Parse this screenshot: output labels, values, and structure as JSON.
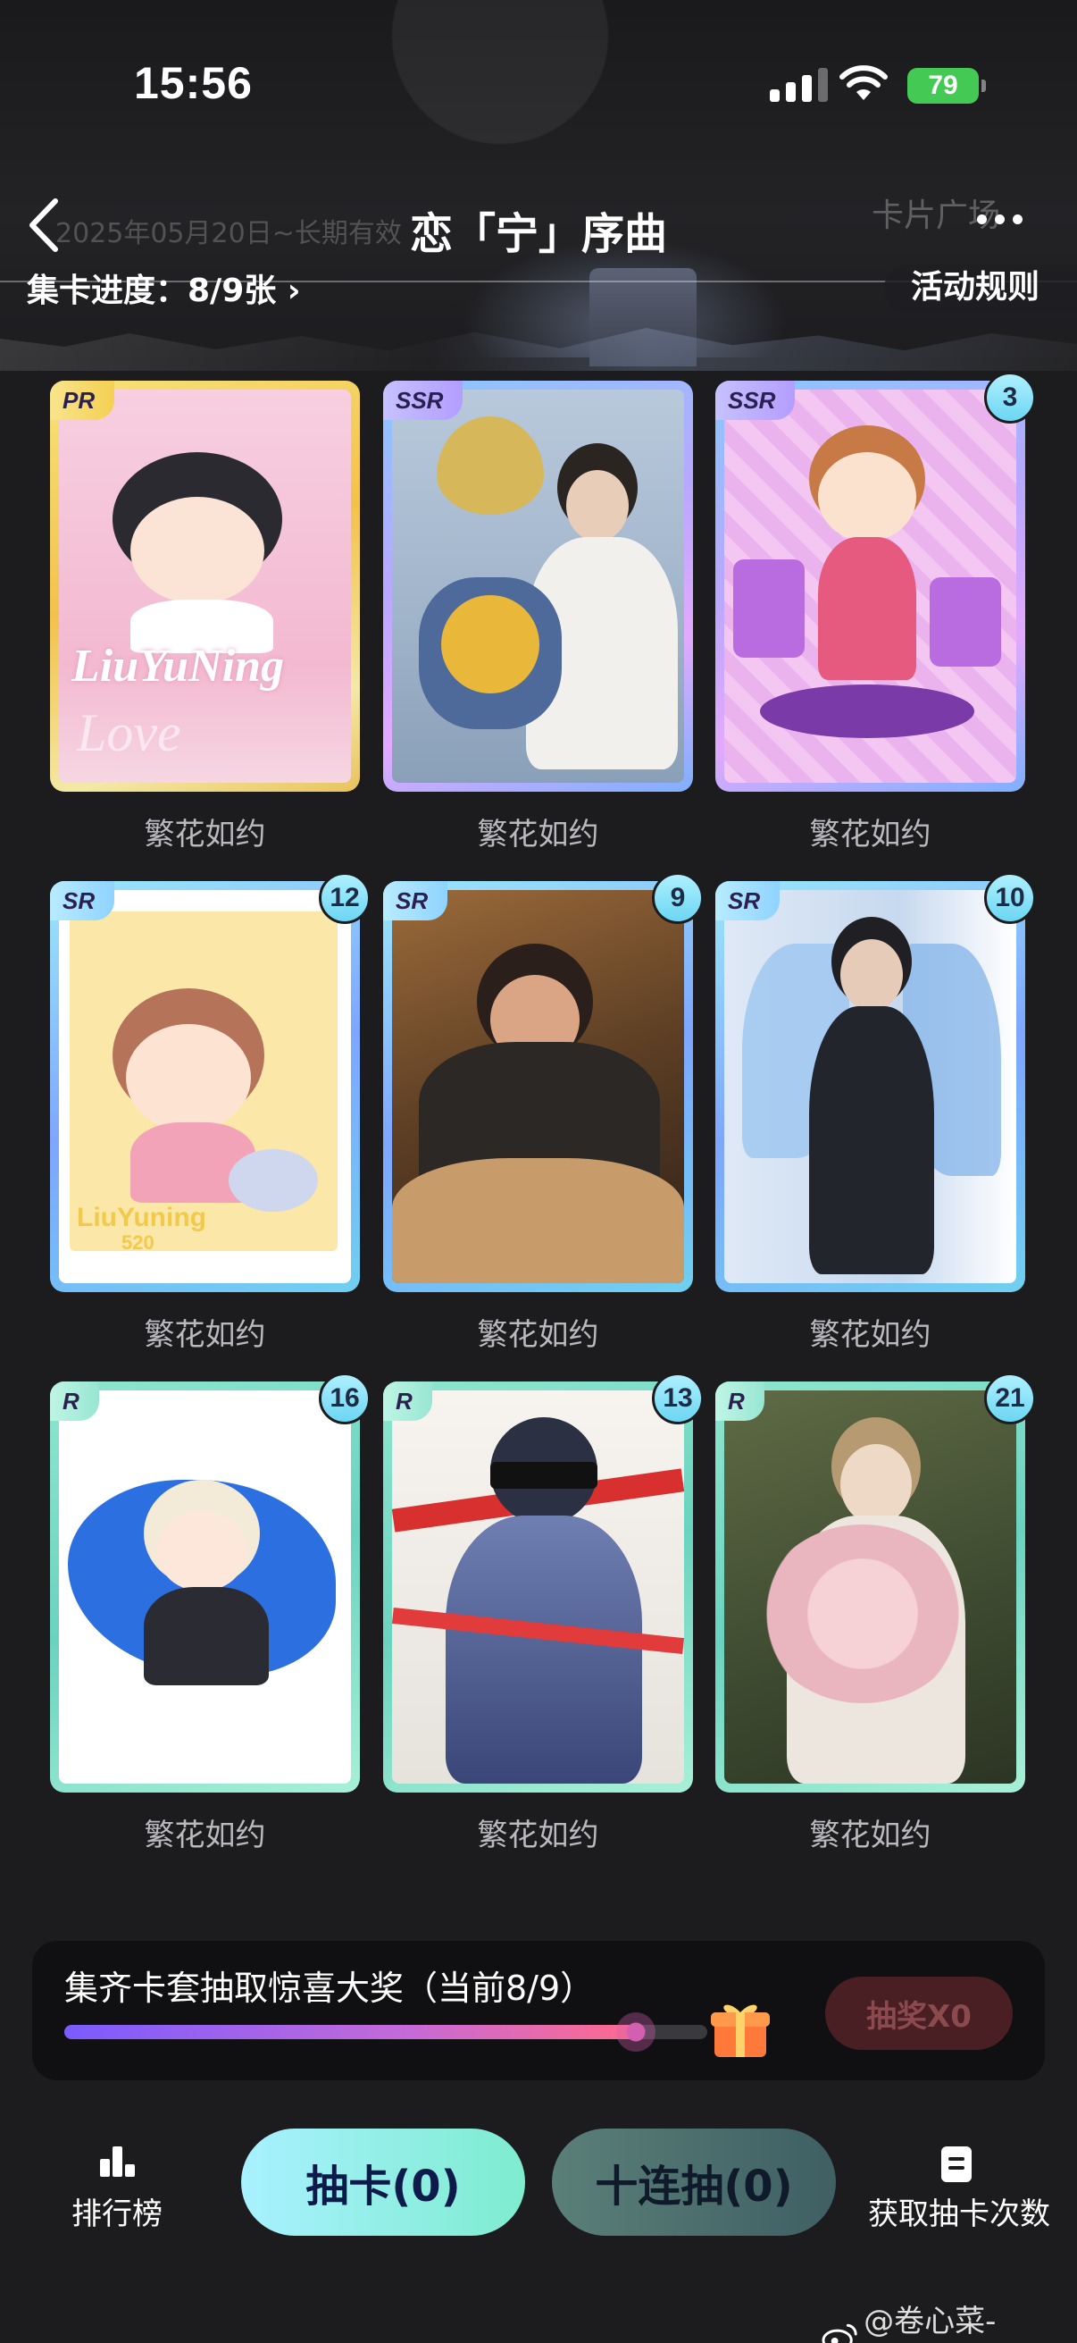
{
  "status_bar": {
    "time": "15:56",
    "battery": "79"
  },
  "nav": {
    "title": "恋「宁」序曲",
    "ghost_left": "2025年05月20日~长期有效",
    "ghost_right": "卡片广场"
  },
  "progress": {
    "label": "集卡进度：8/9张 ›"
  },
  "rules_label": "活动规则",
  "cards": [
    {
      "rarity": "PR",
      "count": "",
      "label": "繁花如约"
    },
    {
      "rarity": "SSR",
      "count": "",
      "label": "繁花如约"
    },
    {
      "rarity": "SSR",
      "count": "3",
      "label": "繁花如约"
    },
    {
      "rarity": "SR",
      "count": "12",
      "label": "繁花如约"
    },
    {
      "rarity": "SR",
      "count": "9",
      "label": "繁花如约"
    },
    {
      "rarity": "SR",
      "count": "10",
      "label": "繁花如约"
    },
    {
      "rarity": "R",
      "count": "16",
      "label": "繁花如约"
    },
    {
      "rarity": "R",
      "count": "13",
      "label": "繁花如约"
    },
    {
      "rarity": "R",
      "count": "21",
      "label": "繁花如约"
    }
  ],
  "card_art_text": {
    "c0_line1": "LiuYuNing",
    "c0_line2": "Love",
    "c3_line1": "LiuYuning",
    "c3_line2": "520"
  },
  "lottery": {
    "title": "集齐卡套抽取惊喜大奖（当前8/9）",
    "progress_fraction": 0.889,
    "button_label": "抽奖X0"
  },
  "bottom_bar": {
    "rank_label": "排行榜",
    "draw_label": "抽卡(0)",
    "ten_draw_label": "十连抽(0)",
    "get_chances_label": "获取抽卡次数"
  },
  "watermark": "@卷心菜-muya",
  "colors": {
    "pr": "#f3c24a",
    "ssr": "#b8a8ff",
    "sr": "#7ea6ff",
    "r": "#6ad3bf",
    "lottery_button": "#4a1f23"
  }
}
